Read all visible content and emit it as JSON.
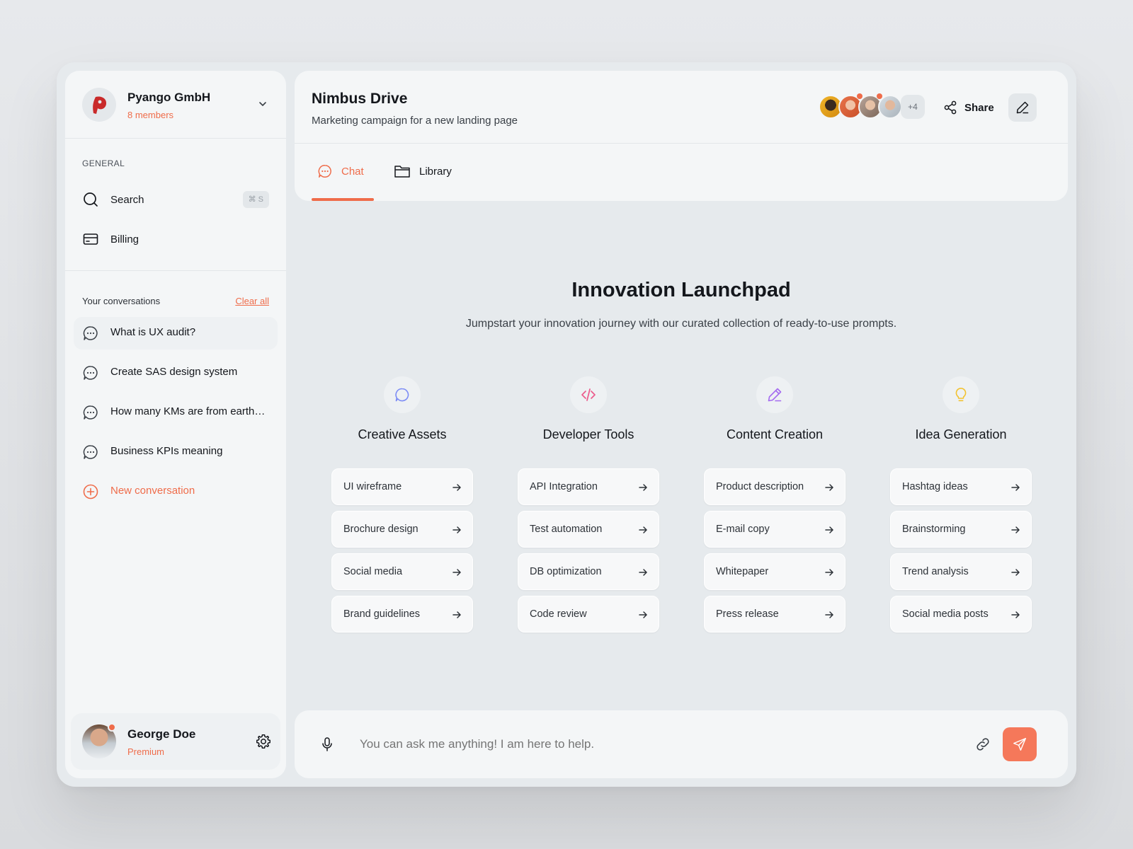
{
  "org": {
    "name": "Pyango GmbH",
    "members": "8 members"
  },
  "sidebar": {
    "section_label": "GENERAL",
    "nav": [
      {
        "label": "Search",
        "icon": "search-icon",
        "shortcut": "⌘ S"
      },
      {
        "label": "Billing",
        "icon": "credit-card-icon"
      }
    ],
    "conversations_title": "Your conversations",
    "clear_all": "Clear all",
    "conversations": [
      {
        "label": "What is UX audit?"
      },
      {
        "label": "Create SAS design system"
      },
      {
        "label": "How many KMs are from earth t..."
      },
      {
        "label": "Business KPIs meaning"
      }
    ],
    "new_conversation": "New conversation"
  },
  "user": {
    "name": "George Doe",
    "plan": "Premium"
  },
  "header": {
    "title": "Nimbus Drive",
    "subtitle": "Marketing campaign for a new landing page",
    "extra_members": "+4",
    "share": "Share",
    "tabs": [
      {
        "label": "Chat",
        "active": true
      },
      {
        "label": "Library",
        "active": false
      }
    ]
  },
  "launchpad": {
    "title": "Innovation Launchpad",
    "subtitle": "Jumpstart your innovation journey with our curated collection of ready-to-use prompts.",
    "categories": [
      {
        "title": "Creative Assets",
        "icon": "chat-bubble-icon",
        "icon_color": "#7c8cf5",
        "prompts": [
          "UI wireframe",
          "Brochure design",
          "Social media",
          "Brand guidelines"
        ]
      },
      {
        "title": "Developer Tools",
        "icon": "code-icon",
        "icon_color": "#ec5b8c",
        "prompts": [
          "API Integration",
          "Test automation",
          "DB optimization",
          "Code review"
        ]
      },
      {
        "title": "Content Creation",
        "icon": "pen-icon",
        "icon_color": "#a56cf0",
        "prompts": [
          "Product description",
          "E-mail copy",
          "Whitepaper",
          "Press release"
        ]
      },
      {
        "title": "Idea Generation",
        "icon": "lightbulb-icon",
        "icon_color": "#f2c230",
        "prompts": [
          "Hashtag ideas",
          "Brainstorming",
          "Trend analysis",
          "Social media posts"
        ]
      }
    ]
  },
  "composer": {
    "placeholder": "You can ask me anything! I am here to help."
  },
  "colors": {
    "accent": "#ef6c4a",
    "surface": "#f4f6f7",
    "frame": "#e6eaed"
  }
}
